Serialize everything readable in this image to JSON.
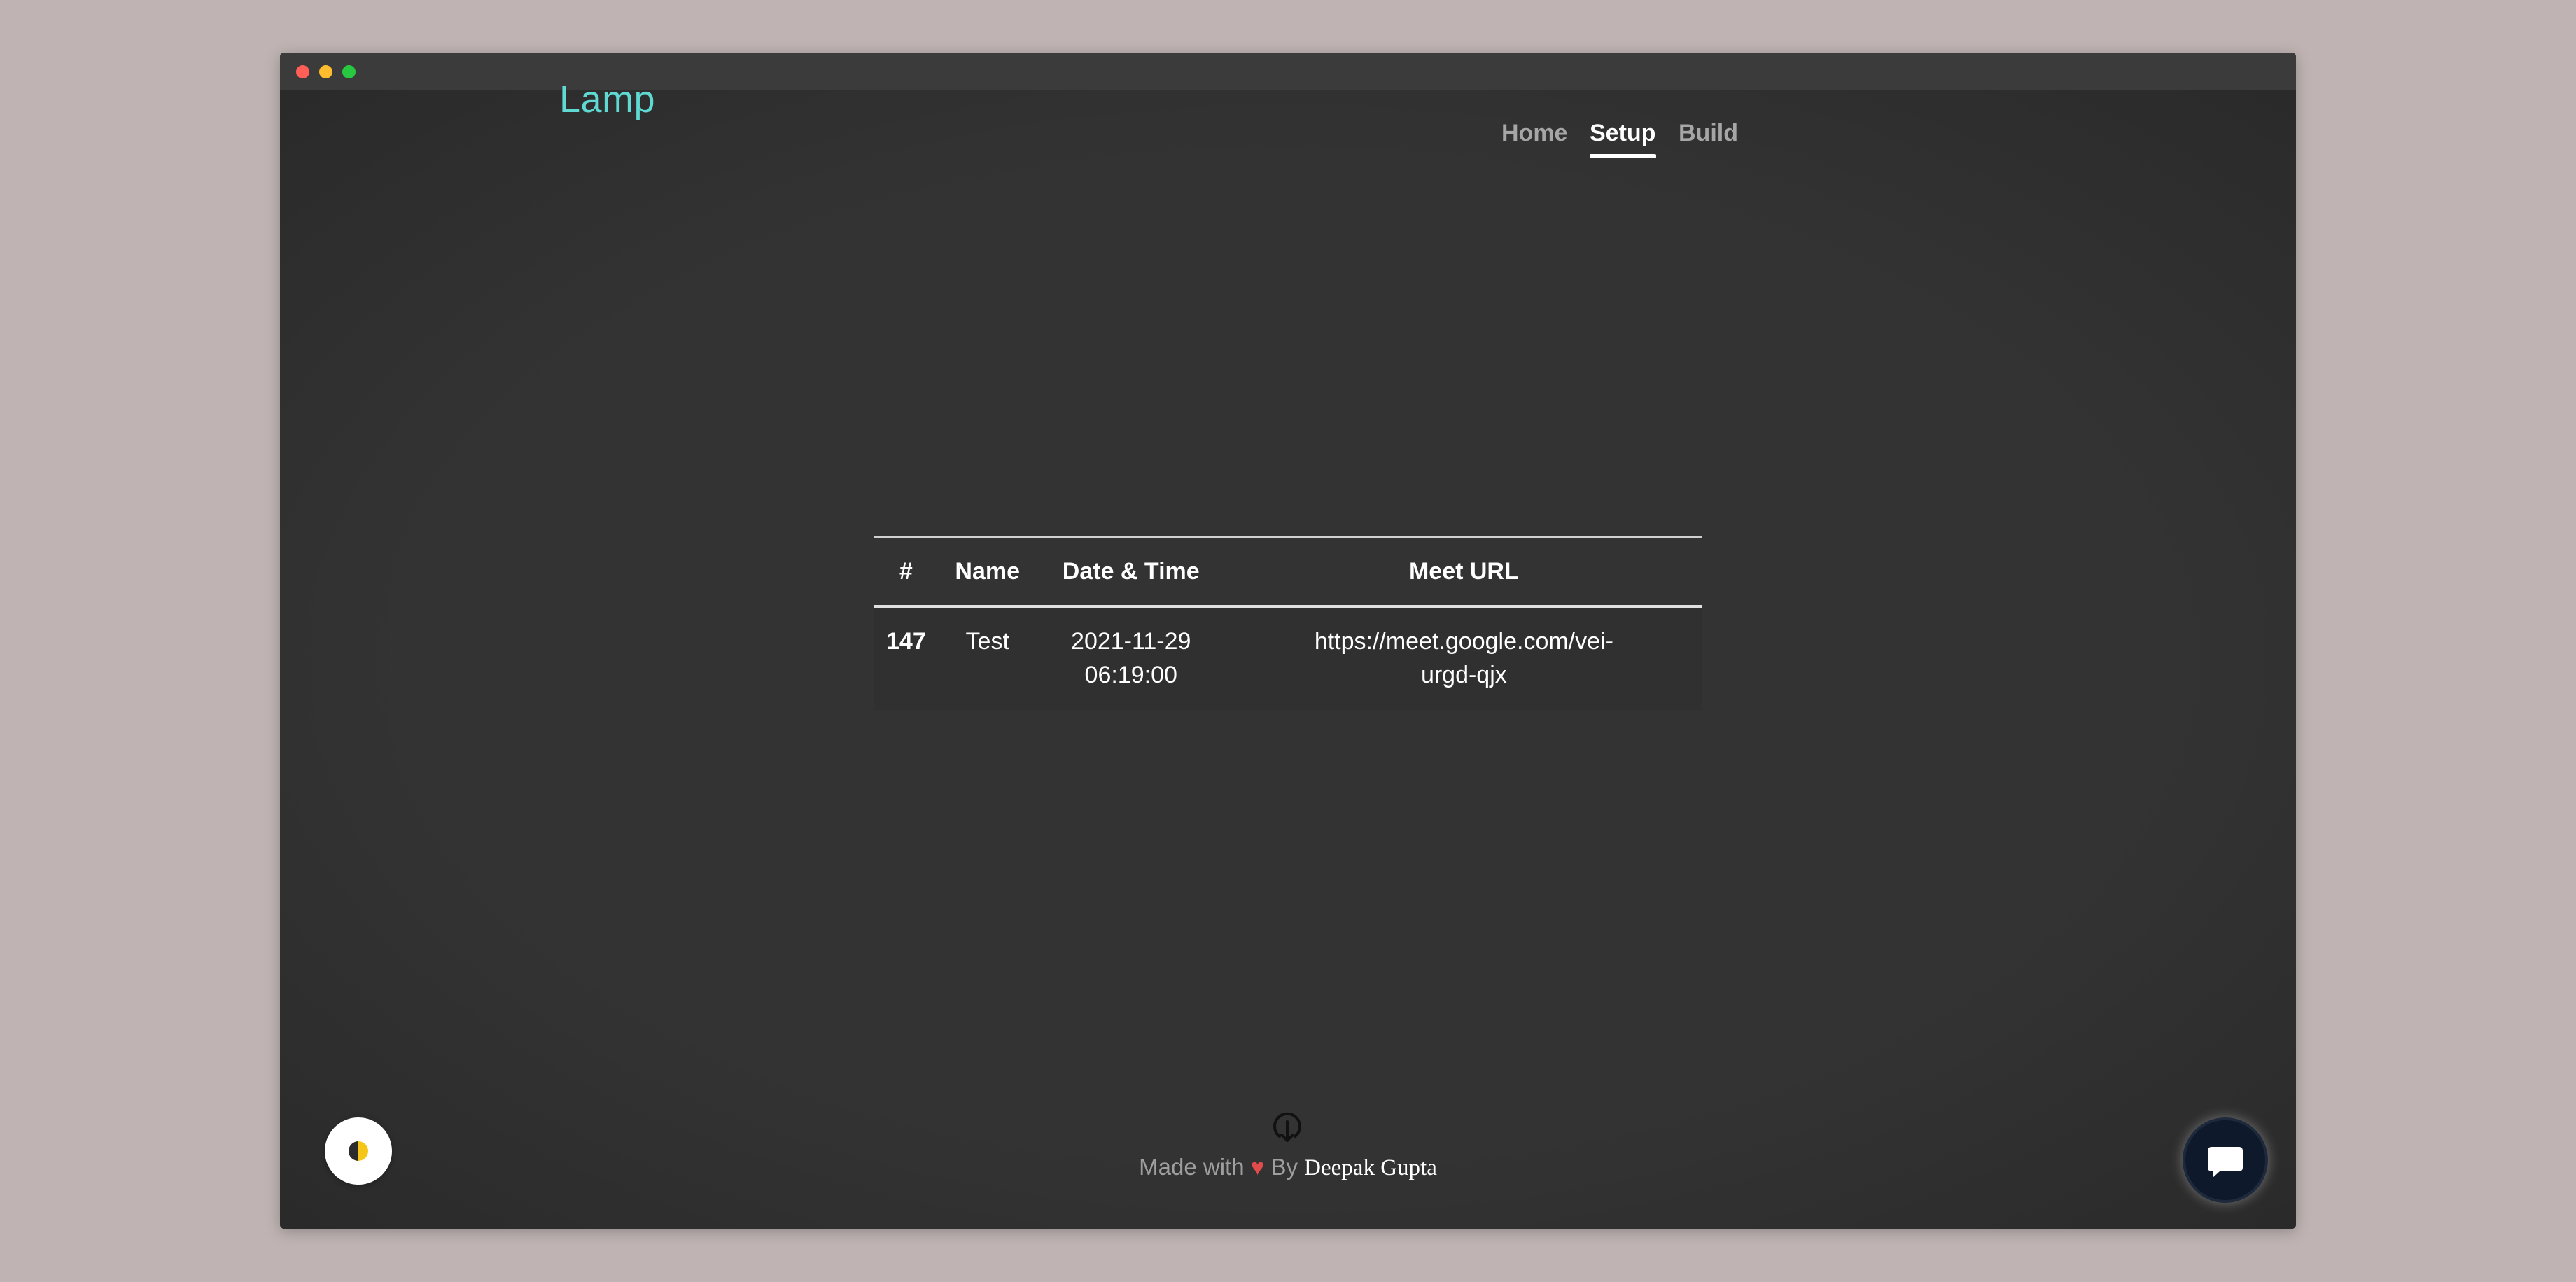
{
  "app": {
    "logo": "Lamp"
  },
  "nav": {
    "items": [
      {
        "label": "Home",
        "active": false
      },
      {
        "label": "Setup",
        "active": true
      },
      {
        "label": "Build",
        "active": false
      }
    ]
  },
  "table": {
    "headers": [
      "#",
      "Name",
      "Date & Time",
      "Meet URL"
    ],
    "rows": [
      {
        "id": "147",
        "name": "Test",
        "date": "2021-11-29",
        "time": "06:19:00",
        "url": "https://meet.google.com/vei-urgd-qjx"
      }
    ]
  },
  "footer": {
    "made_with": "Made with",
    "heart": "♥",
    "by": "By",
    "author": "Deepak Gupta",
    "icon": "download-circle-icon"
  },
  "widgets": {
    "theme_toggle_icon": "half-moon-icon",
    "chat_icon": "chat-bubble-icon"
  },
  "colors": {
    "accent": "#5fd9d2",
    "background": "#333333",
    "heart": "#e04b4b",
    "chat_button": "#0e1a2b"
  }
}
